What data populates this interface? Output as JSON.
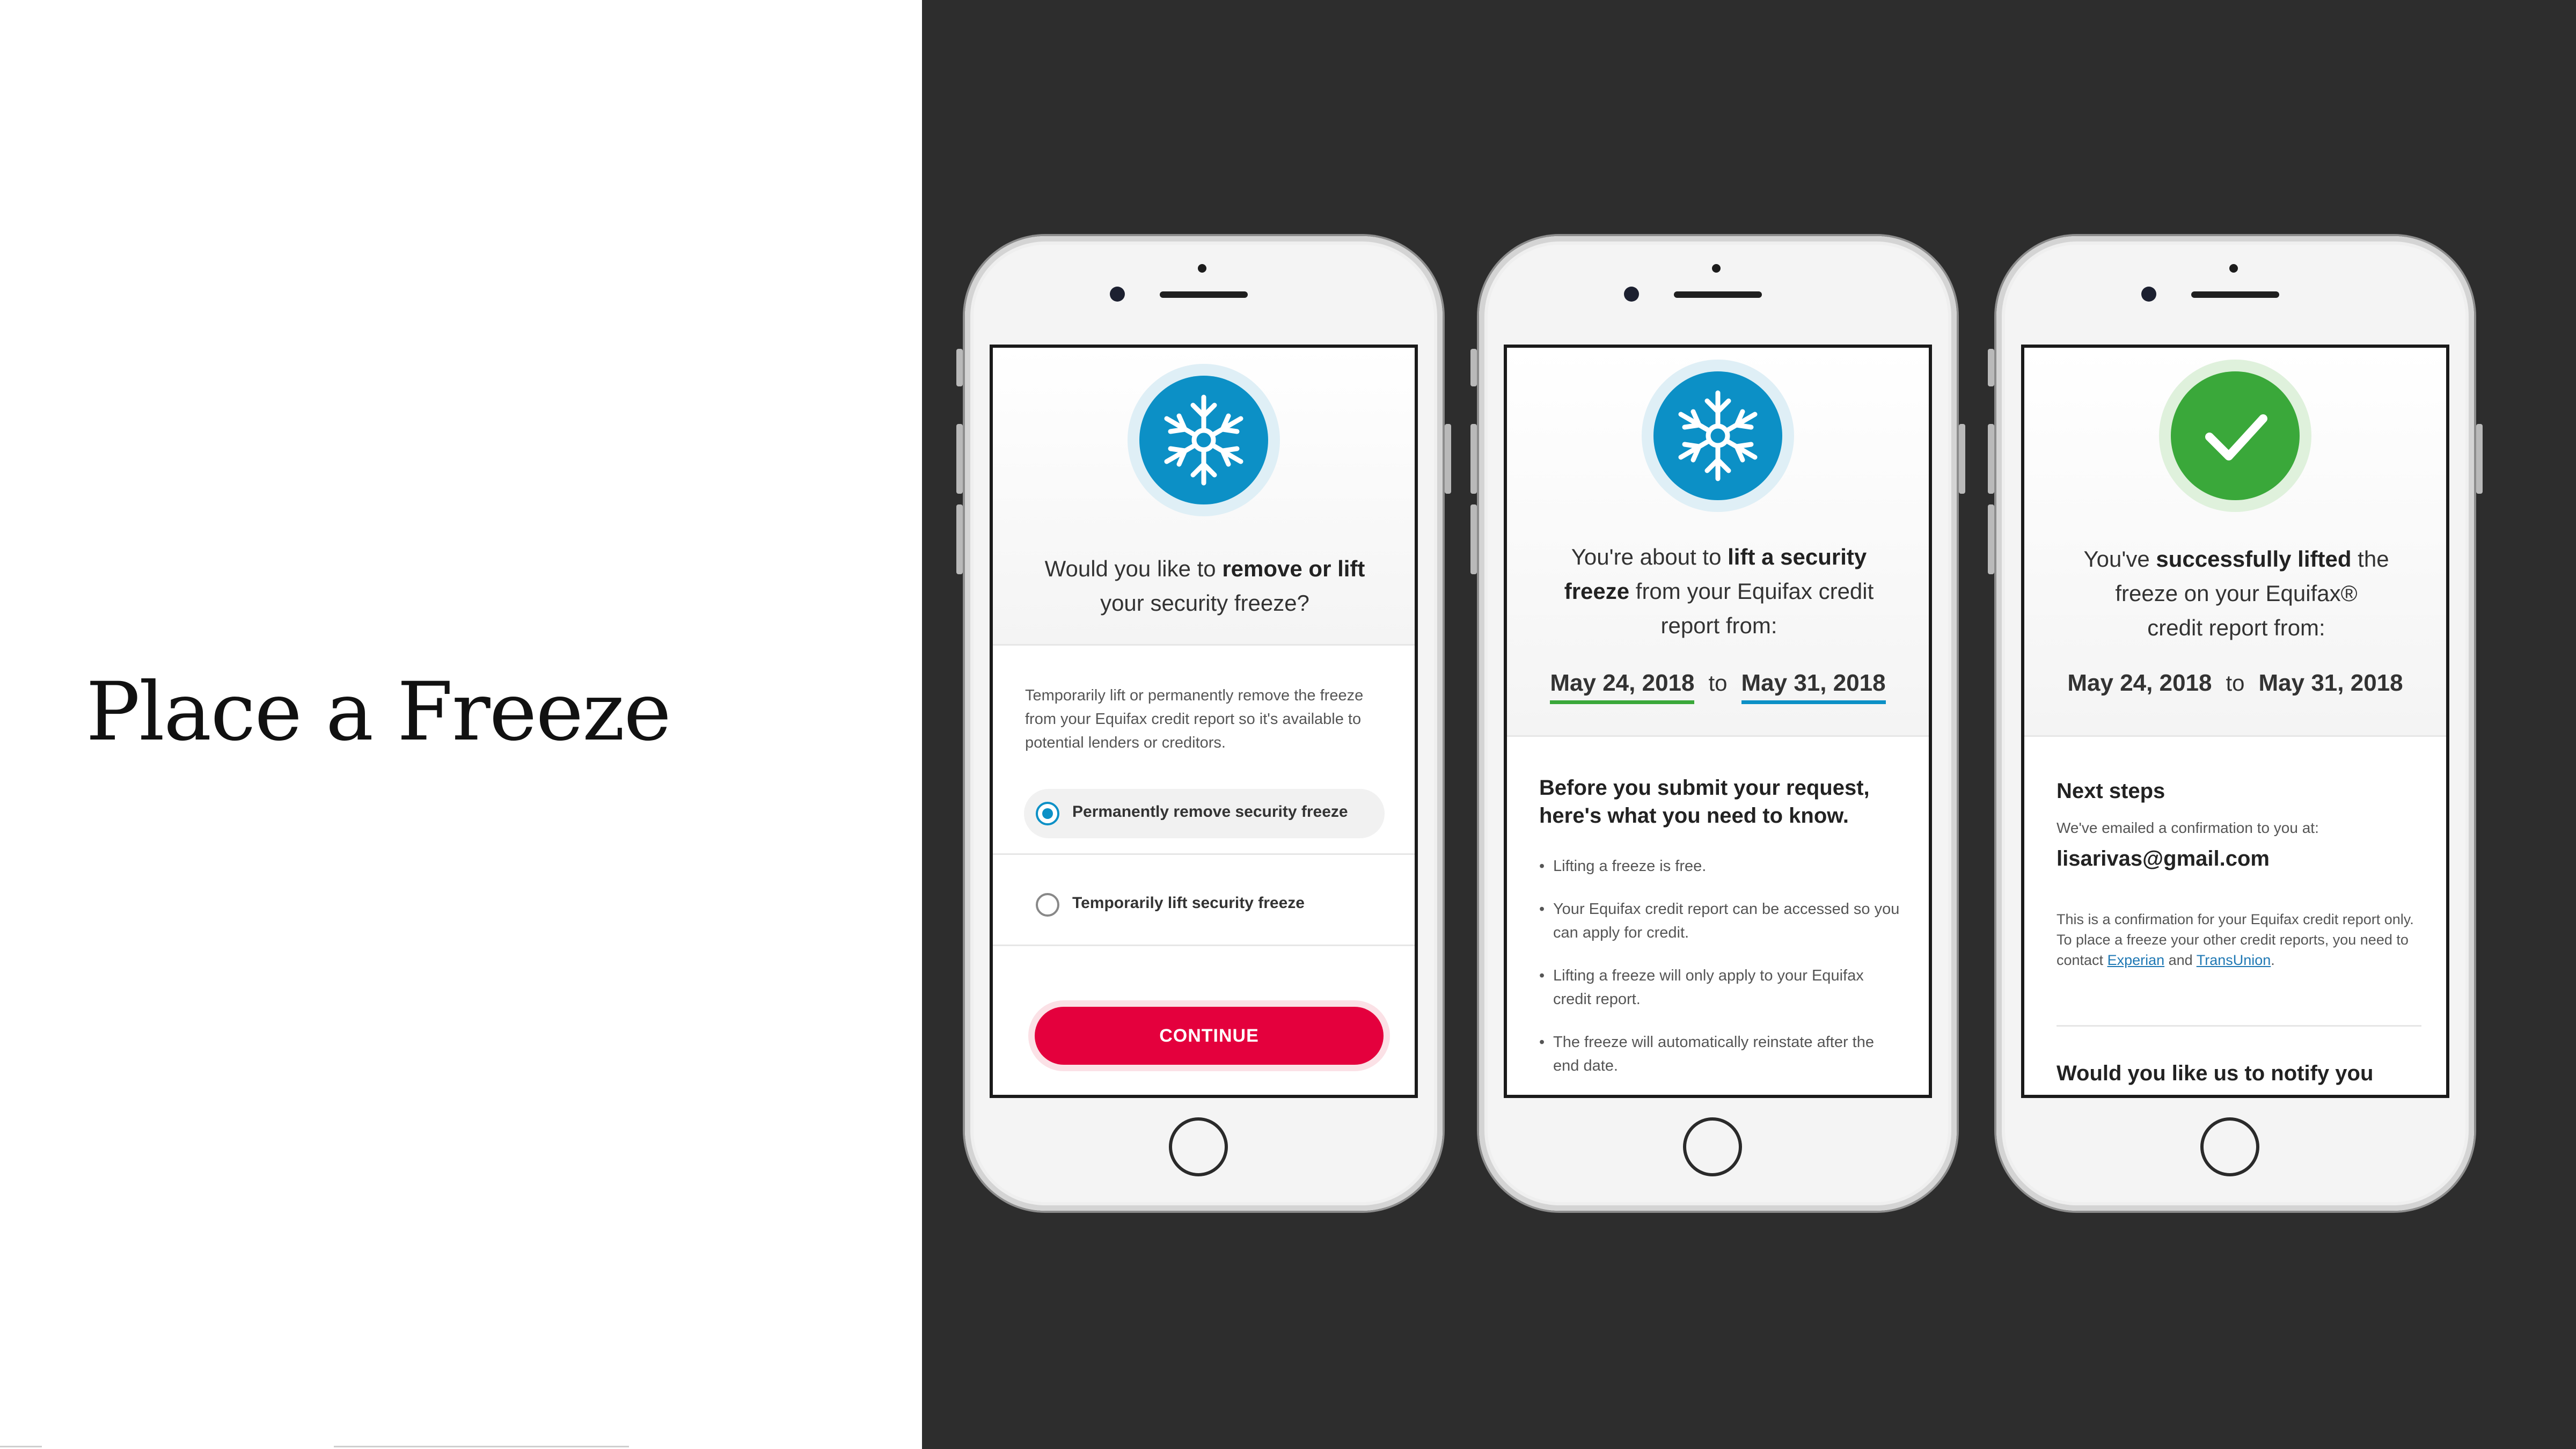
{
  "slide": {
    "title": "Place a Freeze"
  },
  "screen1": {
    "question_pre": "Would you like to ",
    "question_bold": "remove or lift",
    "question_post": "your security freeze?",
    "description": "Temporarily lift or permanently remove the freeze from your Equifax credit report so it's available to potential lenders or creditors.",
    "options": [
      {
        "label": "Permanently remove security freeze",
        "selected": true
      },
      {
        "label": "Temporarily lift security freeze",
        "selected": false
      }
    ],
    "continue_label": "CONTINUE"
  },
  "screen2": {
    "line1_pre": "You're about to ",
    "line1_bold": "lift a security",
    "line2_bold": "freeze",
    "line2_post": " from your Equifax credit",
    "line3": "report from:",
    "start_date": "May 24, 2018",
    "to": "to",
    "end_date": "May 31, 2018",
    "heading": "Before you submit your request, here's what you need to know.",
    "bullets": [
      "Lifting a freeze is free.",
      "Your Equifax credit report can be accessed so you can apply for credit.",
      "Lifting a freeze will only apply to your Equifax credit report.",
      "The freeze will automatically reinstate after the end date."
    ]
  },
  "screen3": {
    "line1_pre": "You've ",
    "line1_bold": "successfully lifted",
    "line1_post": " the",
    "line2": "freeze on your Equifax®",
    "line3": "credit report from:",
    "start_date": "May 24, 2018",
    "to": "to",
    "end_date": "May 31, 2018",
    "next_steps_heading": "Next steps",
    "email_intro": "We've emailed a confirmation to you at:",
    "email": "lisarivas@gmail.com",
    "confirm_text_1": "This is a confirmation for your Equifax credit report only. To place a freeze your other credit reports, you need to contact ",
    "link_experian": "Experian",
    "and": " and ",
    "link_transunion": "TransUnion",
    "period": ".",
    "notify_heading": "Would you like us to notify you"
  },
  "colors": {
    "accent_blue": "#0c90c6",
    "success_green": "#3aa83a",
    "cta_red": "#e4003d",
    "backdrop": "#2d2d2d"
  },
  "icons": [
    "snowflake-icon",
    "checkmark-icon",
    "radio-selected-icon",
    "radio-empty-icon"
  ]
}
